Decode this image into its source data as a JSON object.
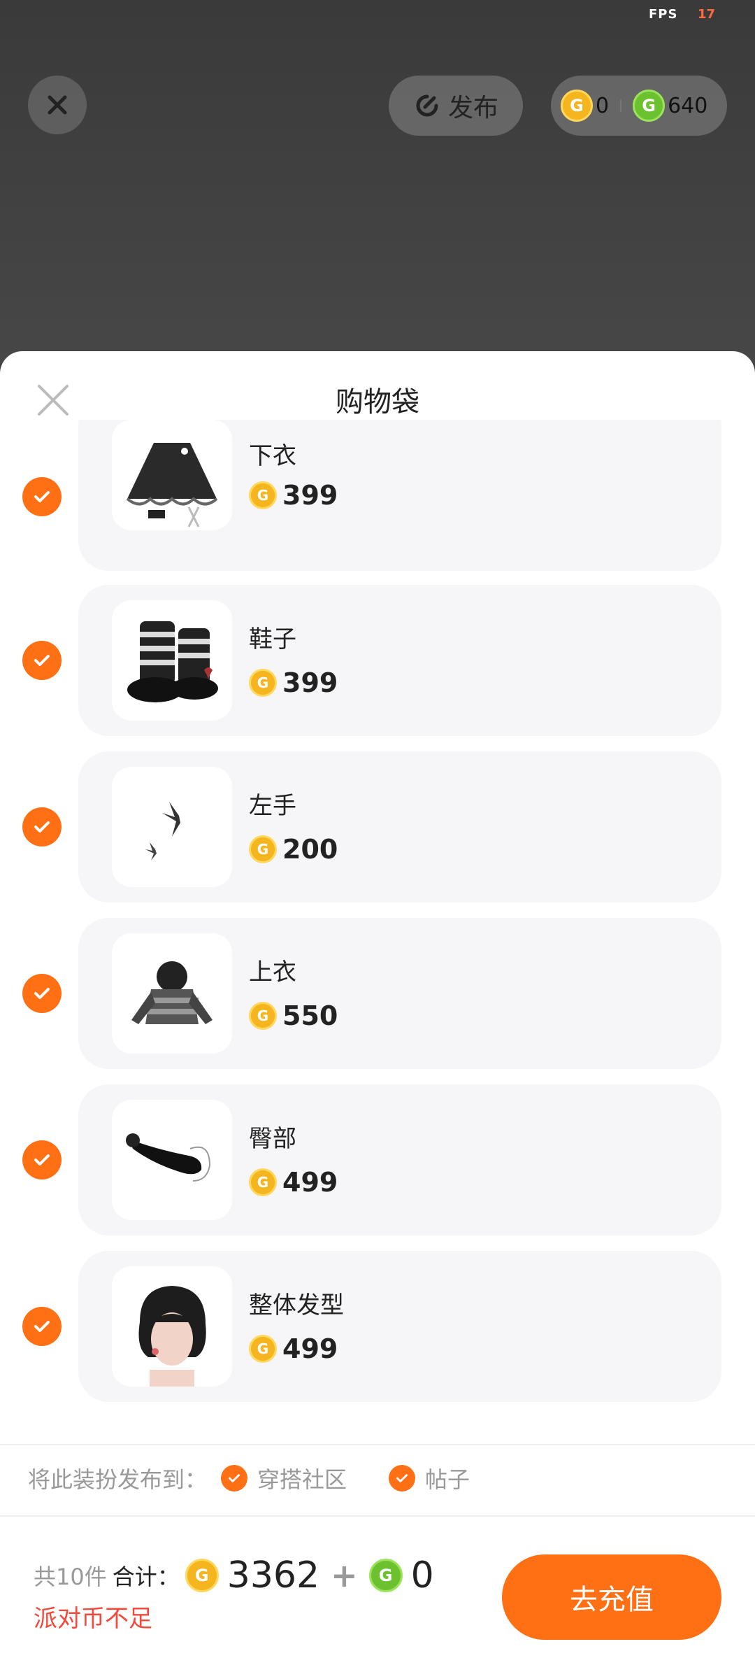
{
  "status": {
    "fps_label": "FPS",
    "fps_value": "17"
  },
  "top": {
    "publish_label": "发布",
    "wallet": {
      "gold_amount": "0",
      "green_amount": "640"
    }
  },
  "sheet": {
    "title": "购物袋"
  },
  "items": [
    {
      "name": "下衣",
      "price": "399",
      "checked": true
    },
    {
      "name": "鞋子",
      "price": "399",
      "checked": true
    },
    {
      "name": "左手",
      "price": "200",
      "checked": true
    },
    {
      "name": "上衣",
      "price": "550",
      "checked": true
    },
    {
      "name": "臀部",
      "price": "499",
      "checked": true
    },
    {
      "name": "整体发型",
      "price": "499",
      "checked": true
    }
  ],
  "publish_to": {
    "label": "将此装扮发布到：",
    "options": [
      {
        "label": "穿搭社区",
        "checked": true
      },
      {
        "label": "帖子",
        "checked": true
      }
    ]
  },
  "footer": {
    "count": "共10件",
    "total_label": "合计：",
    "gold_total": "3362",
    "plus": "+",
    "green_total": "0",
    "warning": "派对币不足",
    "recharge_label": "去充值"
  },
  "colors": {
    "accent": "#ff6f14",
    "warning": "#f04a3c",
    "gold_coin": "#f4b51f",
    "green_coin": "#6cc12e"
  }
}
